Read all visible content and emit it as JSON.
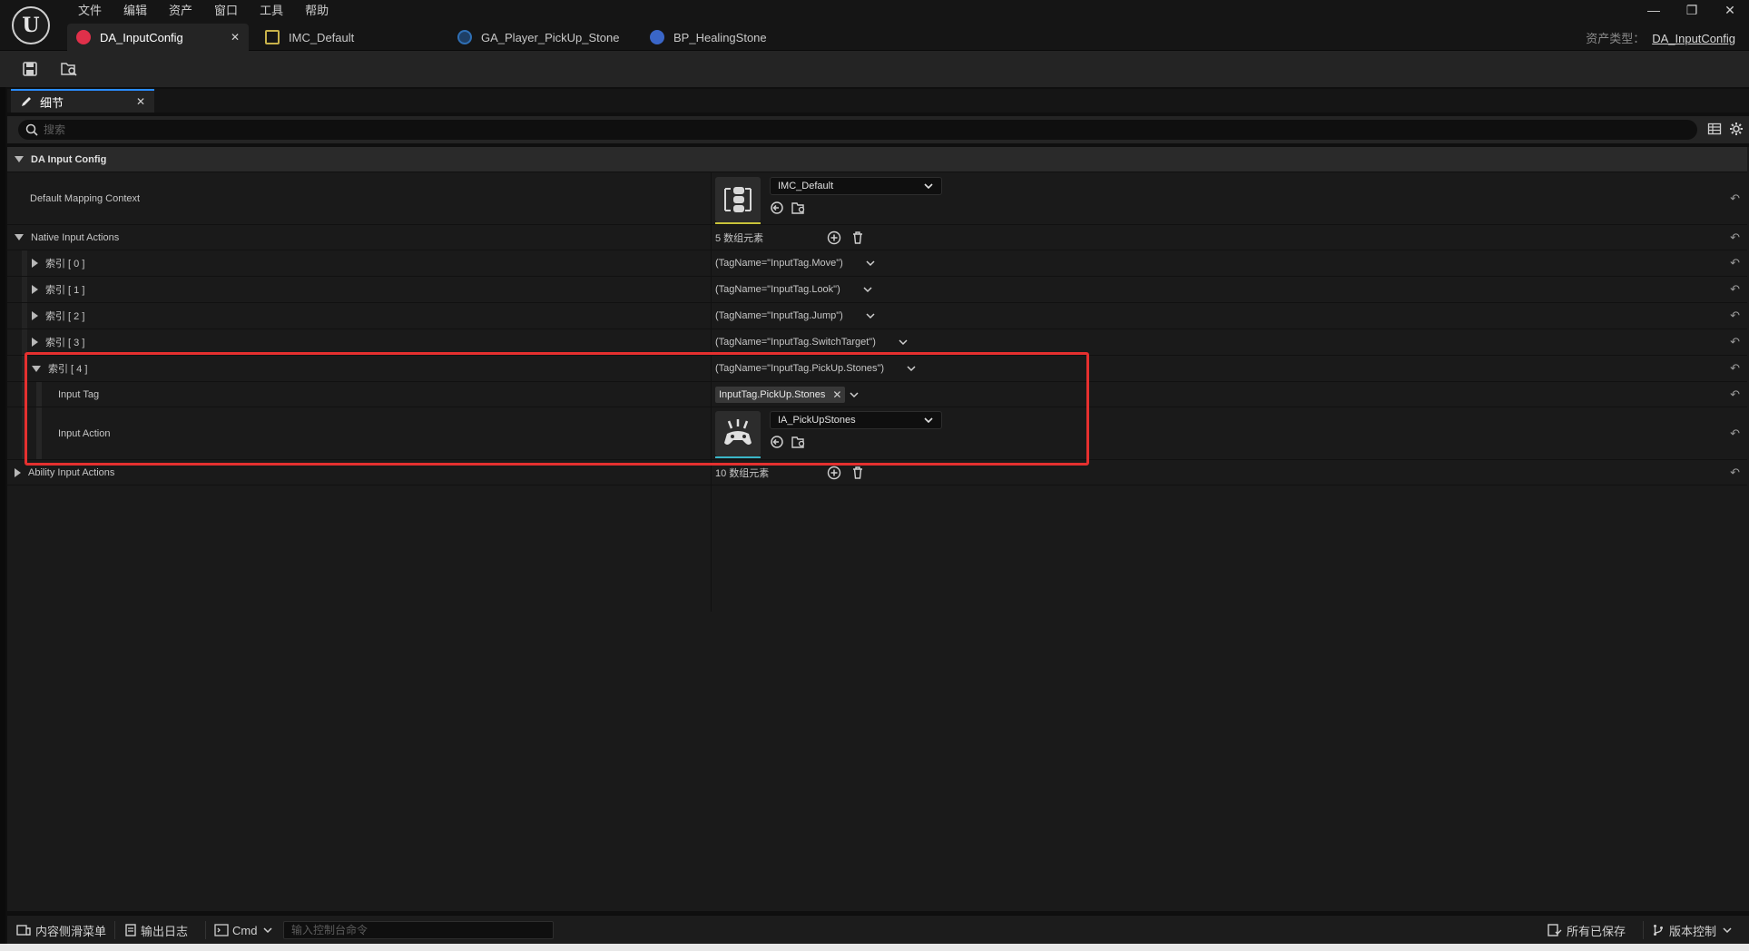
{
  "menu": [
    "文件",
    "编辑",
    "资产",
    "窗口",
    "工具",
    "帮助"
  ],
  "logo_text": "U",
  "window_controls": [
    "—",
    "❐",
    "✕"
  ],
  "tabs": [
    {
      "label": "DA_InputConfig",
      "color": "#e0304a"
    },
    {
      "label": "IMC_Default",
      "color": "#c8b24a"
    },
    {
      "label": "GA_Player_PickUp_Stone",
      "color": "#2f6fb5"
    },
    {
      "label": "BP_HealingStone",
      "color": "#3a66c8"
    }
  ],
  "asset_type": {
    "label": "资产类型：",
    "value": "DA_InputConfig"
  },
  "details_panel": {
    "tab_label": "细节",
    "search_placeholder": "搜索"
  },
  "details": {
    "category": "DA Input Config",
    "default_mapping_context": {
      "label": "Default Mapping Context",
      "value": "IMC_Default"
    },
    "native_input_actions": {
      "label": "Native Input Actions",
      "count": "5 数组元素",
      "items": [
        {
          "label": "索引 [ 0 ]",
          "value": "(TagName=\"InputTag.Move\")"
        },
        {
          "label": "索引 [ 1 ]",
          "value": "(TagName=\"InputTag.Look\")"
        },
        {
          "label": "索引 [ 2 ]",
          "value": "(TagName=\"InputTag.Jump\")"
        },
        {
          "label": "索引 [ 3 ]",
          "value": "(TagName=\"InputTag.SwitchTarget\")"
        },
        {
          "label": "索引 [ 4 ]",
          "value": "(TagName=\"InputTag.PickUp.Stones\")"
        }
      ],
      "expanded": {
        "input_tag_label": "Input Tag",
        "input_tag_value": "InputTag.PickUp.Stones",
        "input_action_label": "Input Action",
        "input_action_value": "IA_PickUpStones"
      }
    },
    "ability_input_actions": {
      "label": "Ability Input Actions",
      "count": "10 数组元素"
    }
  },
  "statusbar": {
    "content_drawer": "内容侧滑菜单",
    "output_log": "输出日志",
    "cmd": "Cmd",
    "cmd_placeholder": "输入控制台命令",
    "all_saved": "所有已保存",
    "source_control": "版本控制"
  },
  "colors": {
    "highlight": "#e5302f",
    "accent": "#2a8cff"
  }
}
